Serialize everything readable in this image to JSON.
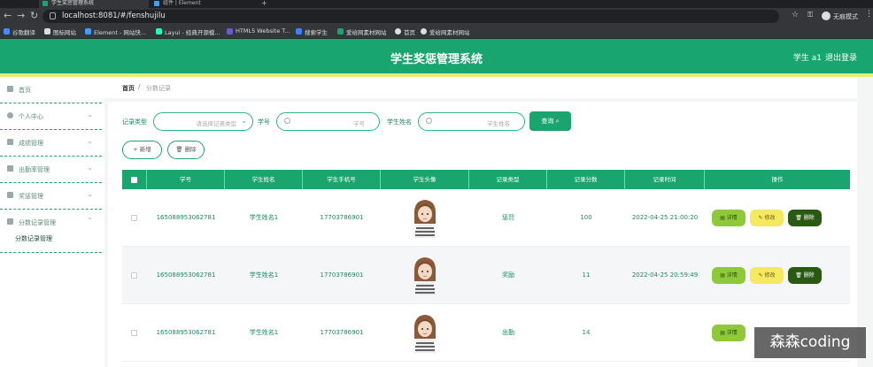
{
  "browser": {
    "tabs": [
      {
        "label": "学生奖惩管理系统",
        "active": true
      },
      {
        "label": "组件 | Element",
        "active": false
      }
    ],
    "url": "localhost:8081/#/fenshujilu",
    "profile_label": "无痕模式",
    "bookmarks": [
      "谷歌翻译",
      "图标网站",
      "Element - 网站快...",
      "Layui - 经典开源模...",
      "HTML5 Website T...",
      "搜索学生",
      "爱给网素材网站",
      "首页",
      "爱给网素材网站"
    ]
  },
  "header": {
    "title": "学生奖惩管理系统",
    "user": "学生 a1",
    "logout": "退出登录"
  },
  "sidebar": {
    "items": [
      {
        "label": "首页",
        "icon": "home-icon",
        "has_chevron": false
      },
      {
        "label": "个人中心",
        "icon": "user-icon",
        "has_chevron": true
      },
      {
        "label": "成绩管理",
        "icon": "score-icon",
        "has_chevron": true
      },
      {
        "label": "出勤率管理",
        "icon": "attendance-icon",
        "has_chevron": true
      },
      {
        "label": "奖惩管理",
        "icon": "reward-icon",
        "has_chevron": true
      },
      {
        "label": "分数记录管理",
        "icon": "record-icon",
        "has_chevron": true
      }
    ],
    "sub_item": "分数记录管理"
  },
  "breadcrumb": {
    "home": "首页",
    "separator": "/",
    "current": "分数记录"
  },
  "filters": {
    "record_type_label": "记录类型",
    "record_type_placeholder": "请选择记录类型",
    "student_no_label": "学号",
    "student_no_placeholder": "学号",
    "student_name_label": "学生姓名",
    "student_name_placeholder": "学生姓名",
    "query_button": "查询"
  },
  "actions": {
    "add": "+ 新增",
    "delete": "删除"
  },
  "table": {
    "columns": [
      "",
      "学号",
      "学生姓名",
      "学生手机号",
      "学生头像",
      "记录类型",
      "记录分数",
      "记录时间",
      "操作"
    ],
    "rows": [
      {
        "student_no": "165088953062781",
        "name": "学生姓名1",
        "phone": "17703786901",
        "type": "惩罚",
        "score": "100",
        "time": "2022-04-25 21:00:20"
      },
      {
        "student_no": "165088953062781",
        "name": "学生姓名1",
        "phone": "17703786901",
        "type": "奖励",
        "score": "11",
        "time": "2022-04-25 20:59:49"
      },
      {
        "student_no": "165088953062781",
        "name": "学生姓名1",
        "phone": "17703786901",
        "type": "出勤",
        "score": "14",
        "time": ""
      }
    ],
    "row_actions": {
      "detail": "详情",
      "edit": "修改",
      "delete": "删除"
    }
  },
  "watermark": "森森coding",
  "colors": {
    "primary": "#1aa56f",
    "header": "#18a56f",
    "accent_yellow": "#e8ea7a",
    "detail_btn": "#8fc93a",
    "edit_btn": "#f5e960",
    "delete_btn": "#2a5a12"
  }
}
